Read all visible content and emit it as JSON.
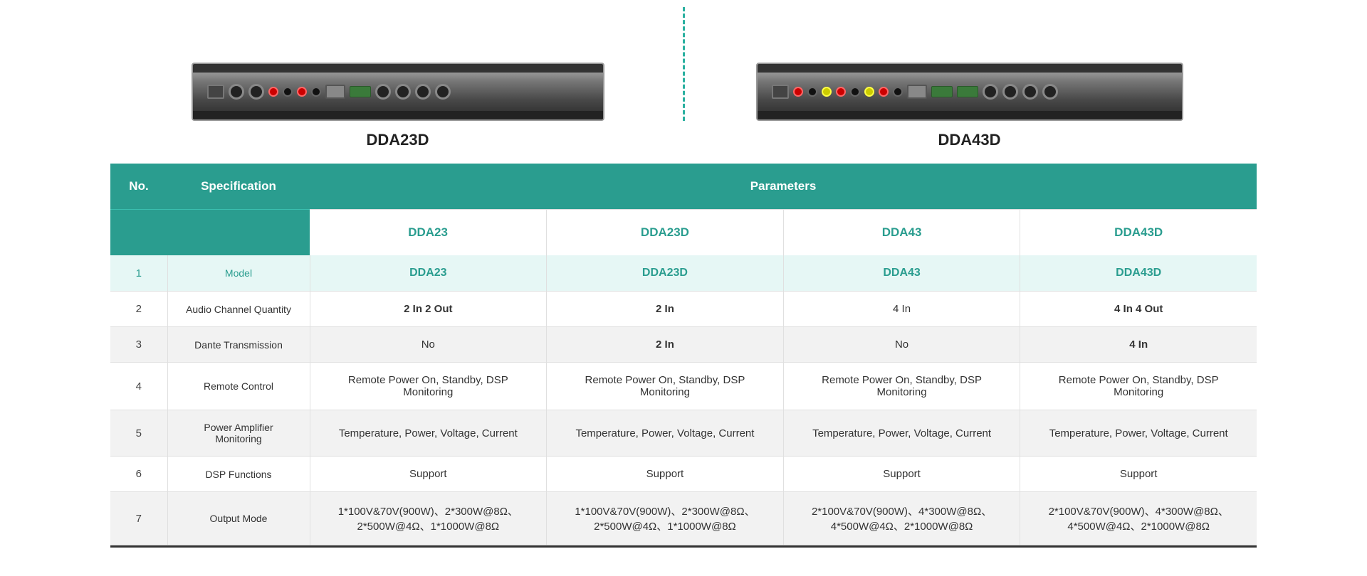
{
  "products": [
    {
      "id": "dda23",
      "name": "DDA23D",
      "image_alt": "DDA23D product rear view"
    },
    {
      "id": "dda43",
      "name": "DDA43D",
      "image_alt": "DDA43D product rear view"
    }
  ],
  "table": {
    "headers": {
      "no": "No.",
      "specification": "Specification",
      "parameters": "Parameters"
    },
    "column_headers": {
      "dda23": "DDA23",
      "dda23d": "DDA23D",
      "dda43": "DDA43",
      "dda43d": "DDA43D"
    },
    "rows": [
      {
        "no": "1",
        "spec": "Model",
        "dda23": "DDA23",
        "dda23d": "DDA23D",
        "dda43": "DDA43",
        "dda43d": "DDA43D",
        "highlight": true,
        "is_model": true
      },
      {
        "no": "2",
        "spec": "Audio Channel Quantity",
        "dda23": "2 In 2 Out",
        "dda23d": "2 In",
        "dda43": "4 In",
        "dda43d": "4 In 4 Out",
        "highlight": false,
        "dda23_bold": true,
        "dda23d_bold": true,
        "dda43d_bold": true
      },
      {
        "no": "3",
        "spec": "Dante Transmission",
        "dda23": "No",
        "dda23d": "2 In",
        "dda43": "No",
        "dda43d": "4 In",
        "highlight": false,
        "dda23d_bold": true,
        "dda43d_bold": true
      },
      {
        "no": "4",
        "spec": "Remote Control",
        "dda23": "Remote Power On, Standby, DSP Monitoring",
        "dda23d": "Remote Power On, Standby, DSP Monitoring",
        "dda43": "Remote Power On, Standby, DSP Monitoring",
        "dda43d": "Remote Power On, Standby, DSP Monitoring",
        "highlight": false
      },
      {
        "no": "5",
        "spec": "Power Amplifier Monitoring",
        "dda23": "Temperature, Power, Voltage, Current",
        "dda23d": "Temperature, Power, Voltage, Current",
        "dda43": "Temperature, Power, Voltage, Current",
        "dda43d": "Temperature, Power, Voltage, Current",
        "highlight": false
      },
      {
        "no": "6",
        "spec": "DSP Functions",
        "dda23": "Support",
        "dda23d": "Support",
        "dda43": "Support",
        "dda43d": "Support",
        "highlight": false
      },
      {
        "no": "7",
        "spec": "Output Mode",
        "dda23": "1*100V&70V(900W)、2*300W@8Ω、2*500W@4Ω、1*1000W@8Ω",
        "dda23d": "1*100V&70V(900W)、2*300W@8Ω、2*500W@4Ω、1*1000W@8Ω",
        "dda43": "2*100V&70V(900W)、4*300W@8Ω、4*500W@4Ω、2*1000W@8Ω",
        "dda43d": "2*100V&70V(900W)、4*300W@8Ω、4*500W@4Ω、2*1000W@8Ω",
        "highlight": false
      }
    ]
  }
}
